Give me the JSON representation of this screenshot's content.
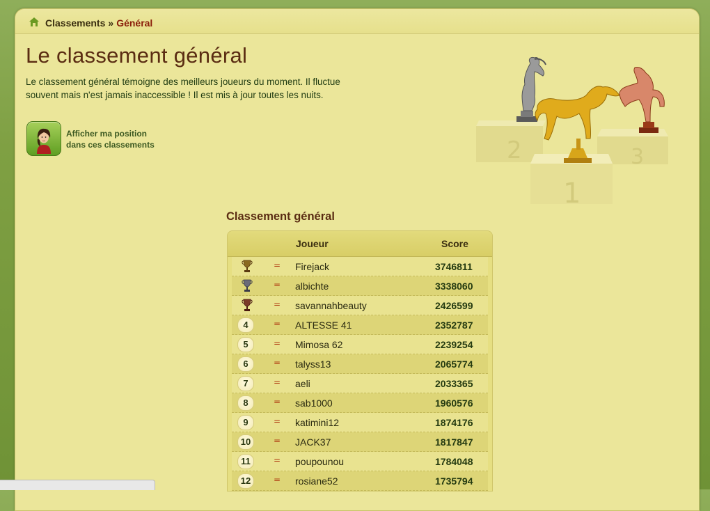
{
  "breadcrumb": {
    "home_label": "Classements",
    "separator": "»",
    "current": "Général"
  },
  "page": {
    "title": "Le classement général",
    "intro": "Le classement général témoigne des meilleurs joueurs du moment. Il fluctue souvent mais n'est jamais inaccessible ! Il est mis à jour toutes les nuits.",
    "position_button_label_line1": "Afficher ma position",
    "position_button_label_line2": "dans ces classements"
  },
  "podium": {
    "places": [
      "1",
      "2",
      "3"
    ],
    "colors": {
      "gold": "#d7a51a",
      "silver": "#9a9a9a",
      "bronze": "#c8704a"
    }
  },
  "ranking": {
    "title": "Classement général",
    "headers": {
      "player": "Joueur",
      "score": "Score"
    },
    "rows": [
      {
        "rank": "1",
        "icon": "gold-trophy-icon",
        "trend": "=",
        "player": "Firejack",
        "score": "3746811"
      },
      {
        "rank": "2",
        "icon": "silver-trophy-icon",
        "trend": "=",
        "player": "albichte",
        "score": "3338060"
      },
      {
        "rank": "3",
        "icon": "bronze-trophy-icon",
        "trend": "=",
        "player": "savannahbeauty",
        "score": "2426599"
      },
      {
        "rank": "4",
        "trend": "=",
        "player": "ALTESSE 41",
        "score": "2352787"
      },
      {
        "rank": "5",
        "trend": "=",
        "player": "Mimosa 62",
        "score": "2239254"
      },
      {
        "rank": "6",
        "trend": "=",
        "player": "talyss13",
        "score": "2065774"
      },
      {
        "rank": "7",
        "trend": "=",
        "player": "aeli",
        "score": "2033365"
      },
      {
        "rank": "8",
        "trend": "=",
        "player": "sab1000",
        "score": "1960576"
      },
      {
        "rank": "9",
        "trend": "=",
        "player": "katimini12",
        "score": "1874176"
      },
      {
        "rank": "10",
        "trend": "=",
        "player": "JACK37",
        "score": "1817847"
      },
      {
        "rank": "11",
        "trend": "=",
        "player": "poupounou",
        "score": "1784048"
      },
      {
        "rank": "12",
        "trend": "=",
        "player": "rosiane52",
        "score": "1735794"
      }
    ]
  },
  "colors": {
    "title": "#5a2c12",
    "accent_link": "#8a1e0a",
    "panel": "#ebe69a",
    "background": "#7fa043"
  }
}
